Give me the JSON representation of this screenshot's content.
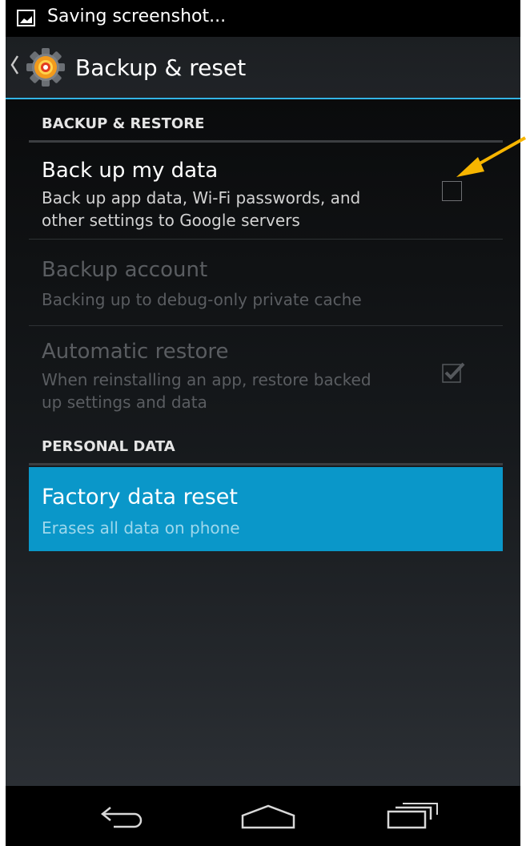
{
  "status_bar": {
    "notification_icon": "gallery-icon",
    "text": "Saving screenshot..."
  },
  "action_bar": {
    "up_icon": "up-caret-icon",
    "app_icon": "settings-gear-icon",
    "title": "Backup & reset"
  },
  "sections": {
    "backup_restore": {
      "header": "BACKUP & RESTORE",
      "items": [
        {
          "title": "Back up my data",
          "summary_line1": "Back up app data, Wi-Fi passwords, and",
          "summary_line2": "other settings to Google servers",
          "enabled": true,
          "checkbox_checked": false
        },
        {
          "title": "Backup account",
          "summary_line1": "Backing up to debug-only private cache",
          "enabled": false
        },
        {
          "title": "Automatic restore",
          "summary_line1": "When reinstalling an app, restore backed",
          "summary_line2": "up settings and data",
          "enabled": false,
          "checkbox_checked": true
        }
      ]
    },
    "personal_data": {
      "header": "PERSONAL DATA",
      "items": [
        {
          "title": "Factory data reset",
          "summary": "Erases all data on phone",
          "highlighted": true
        }
      ]
    }
  },
  "nav_bar": {
    "back_icon": "back-icon",
    "home_icon": "home-icon",
    "recents_icon": "recent-apps-icon"
  },
  "colors": {
    "accent_blue": "#33b5e5",
    "highlight": "#0a97c9",
    "annotation_arrow": "#f7b500"
  }
}
